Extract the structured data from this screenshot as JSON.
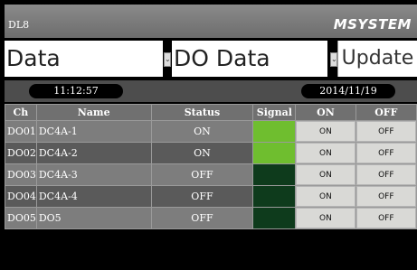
{
  "app": {
    "title": "DL8",
    "logo": "MSYSTEM"
  },
  "controls": {
    "category": "Data",
    "view": "DO Data",
    "dropdown_arrow": "⌄",
    "update_label": "Update"
  },
  "status": {
    "time": "11:12:57",
    "date": "2014/11/19"
  },
  "table": {
    "headers": {
      "ch": "Ch",
      "name": "Name",
      "status": "Status",
      "signal": "Signal",
      "on": "ON",
      "off": "OFF"
    },
    "rows": [
      {
        "ch": "DO01",
        "name": "DC4A-1",
        "status": "ON",
        "signal": "on",
        "on_label": "ON",
        "off_label": "OFF"
      },
      {
        "ch": "DO02",
        "name": "DC4A-2",
        "status": "ON",
        "signal": "on",
        "on_label": "ON",
        "off_label": "OFF"
      },
      {
        "ch": "DO03",
        "name": "DC4A-3",
        "status": "OFF",
        "signal": "off",
        "on_label": "ON",
        "off_label": "OFF"
      },
      {
        "ch": "DO04",
        "name": "DC4A-4",
        "status": "OFF",
        "signal": "off",
        "on_label": "ON",
        "off_label": "OFF"
      },
      {
        "ch": "DO05",
        "name": "DO5",
        "status": "OFF",
        "signal": "off",
        "on_label": "ON",
        "off_label": "OFF"
      }
    ]
  },
  "colors": {
    "signal_on": "#6fbe2f",
    "signal_off": "#0e3b1c",
    "header_bg": "#707070",
    "topbar": "#7a7a7a"
  }
}
